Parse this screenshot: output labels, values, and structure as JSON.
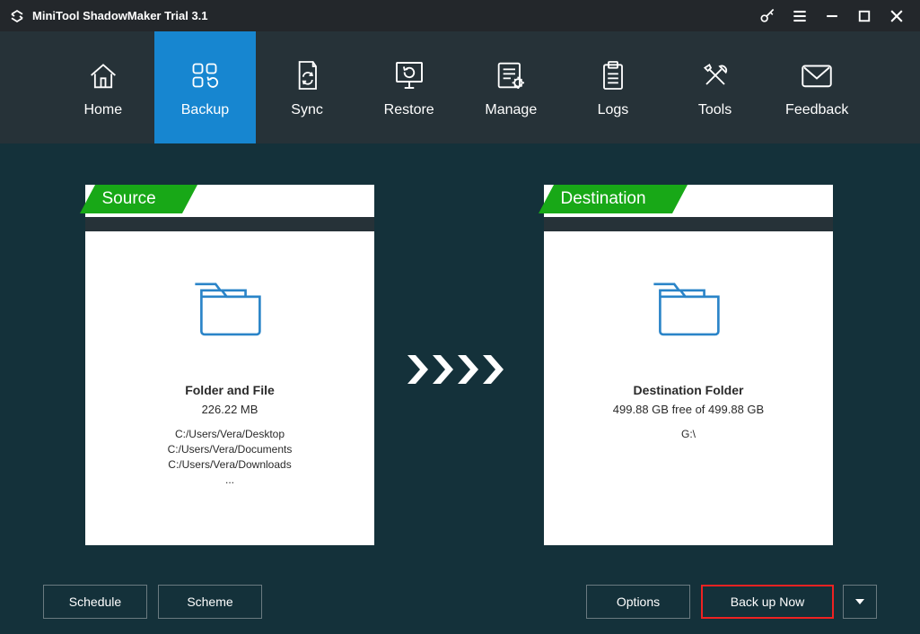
{
  "titlebar": {
    "title": "MiniTool ShadowMaker Trial 3.1"
  },
  "nav": {
    "items": [
      {
        "label": "Home"
      },
      {
        "label": "Backup"
      },
      {
        "label": "Sync"
      },
      {
        "label": "Restore"
      },
      {
        "label": "Manage"
      },
      {
        "label": "Logs"
      },
      {
        "label": "Tools"
      },
      {
        "label": "Feedback"
      }
    ]
  },
  "source": {
    "tab": "Source",
    "title": "Folder and File",
    "size": "226.22 MB",
    "paths": [
      "C:/Users/Vera/Desktop",
      "C:/Users/Vera/Documents",
      "C:/Users/Vera/Downloads",
      "..."
    ]
  },
  "destination": {
    "tab": "Destination",
    "title": "Destination Folder",
    "size": "499.88 GB free of 499.88 GB",
    "path": "G:\\"
  },
  "footer": {
    "schedule": "Schedule",
    "scheme": "Scheme",
    "options": "Options",
    "backup": "Back up Now"
  }
}
